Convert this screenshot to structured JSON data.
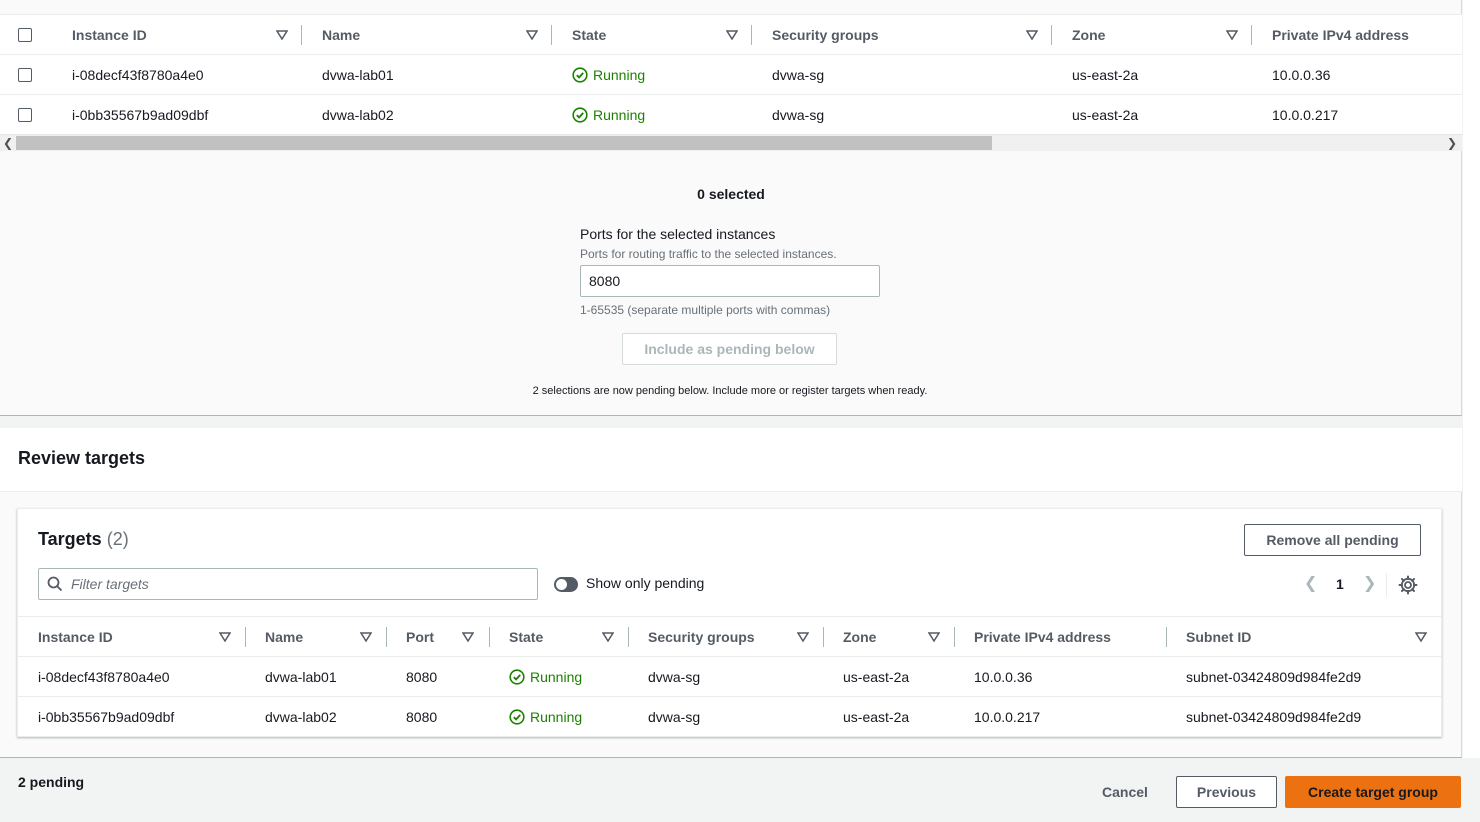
{
  "instances_table": {
    "columns": [
      "Instance ID",
      "Name",
      "State",
      "Security groups",
      "Zone",
      "Private IPv4 address"
    ],
    "rows": [
      {
        "instance_id": "i-08decf43f8780a4e0",
        "name": "dvwa-lab01",
        "state": "Running",
        "security_groups": "dvwa-sg",
        "zone": "us-east-2a",
        "private_ip": "10.0.0.36"
      },
      {
        "instance_id": "i-0bb35567b9ad09dbf",
        "name": "dvwa-lab02",
        "state": "Running",
        "security_groups": "dvwa-sg",
        "zone": "us-east-2a",
        "private_ip": "10.0.0.217"
      }
    ]
  },
  "selection": {
    "count_label": "0 selected",
    "ports_label": "Ports for the selected instances",
    "ports_description": "Ports for routing traffic to the selected instances.",
    "ports_value": "8080",
    "ports_hint": "1-65535 (separate multiple ports with commas)",
    "include_button": "Include as pending below",
    "pending_note": "2 selections are now pending below. Include more or register targets when ready."
  },
  "review": {
    "title": "Review targets",
    "targets_title": "Targets",
    "targets_count": "(2)",
    "remove_all_button": "Remove all pending",
    "filter_placeholder": "Filter targets",
    "toggle_label": "Show only pending",
    "page": "1",
    "columns": [
      "Instance ID",
      "Name",
      "Port",
      "State",
      "Security groups",
      "Zone",
      "Private IPv4 address",
      "Subnet ID"
    ],
    "rows": [
      {
        "instance_id": "i-08decf43f8780a4e0",
        "name": "dvwa-lab01",
        "port": "8080",
        "state": "Running",
        "security_groups": "dvwa-sg",
        "zone": "us-east-2a",
        "private_ip": "10.0.0.36",
        "subnet_id": "subnet-03424809d984fe2d9"
      },
      {
        "instance_id": "i-0bb35567b9ad09dbf",
        "name": "dvwa-lab02",
        "port": "8080",
        "state": "Running",
        "security_groups": "dvwa-sg",
        "zone": "us-east-2a",
        "private_ip": "10.0.0.217",
        "subnet_id": "subnet-03424809d984fe2d9"
      }
    ]
  },
  "footer": {
    "pending_count": "2 pending",
    "cancel": "Cancel",
    "previous": "Previous",
    "create": "Create target group"
  },
  "colors": {
    "accent_orange": "#ec7211",
    "status_green": "#1d8102"
  }
}
